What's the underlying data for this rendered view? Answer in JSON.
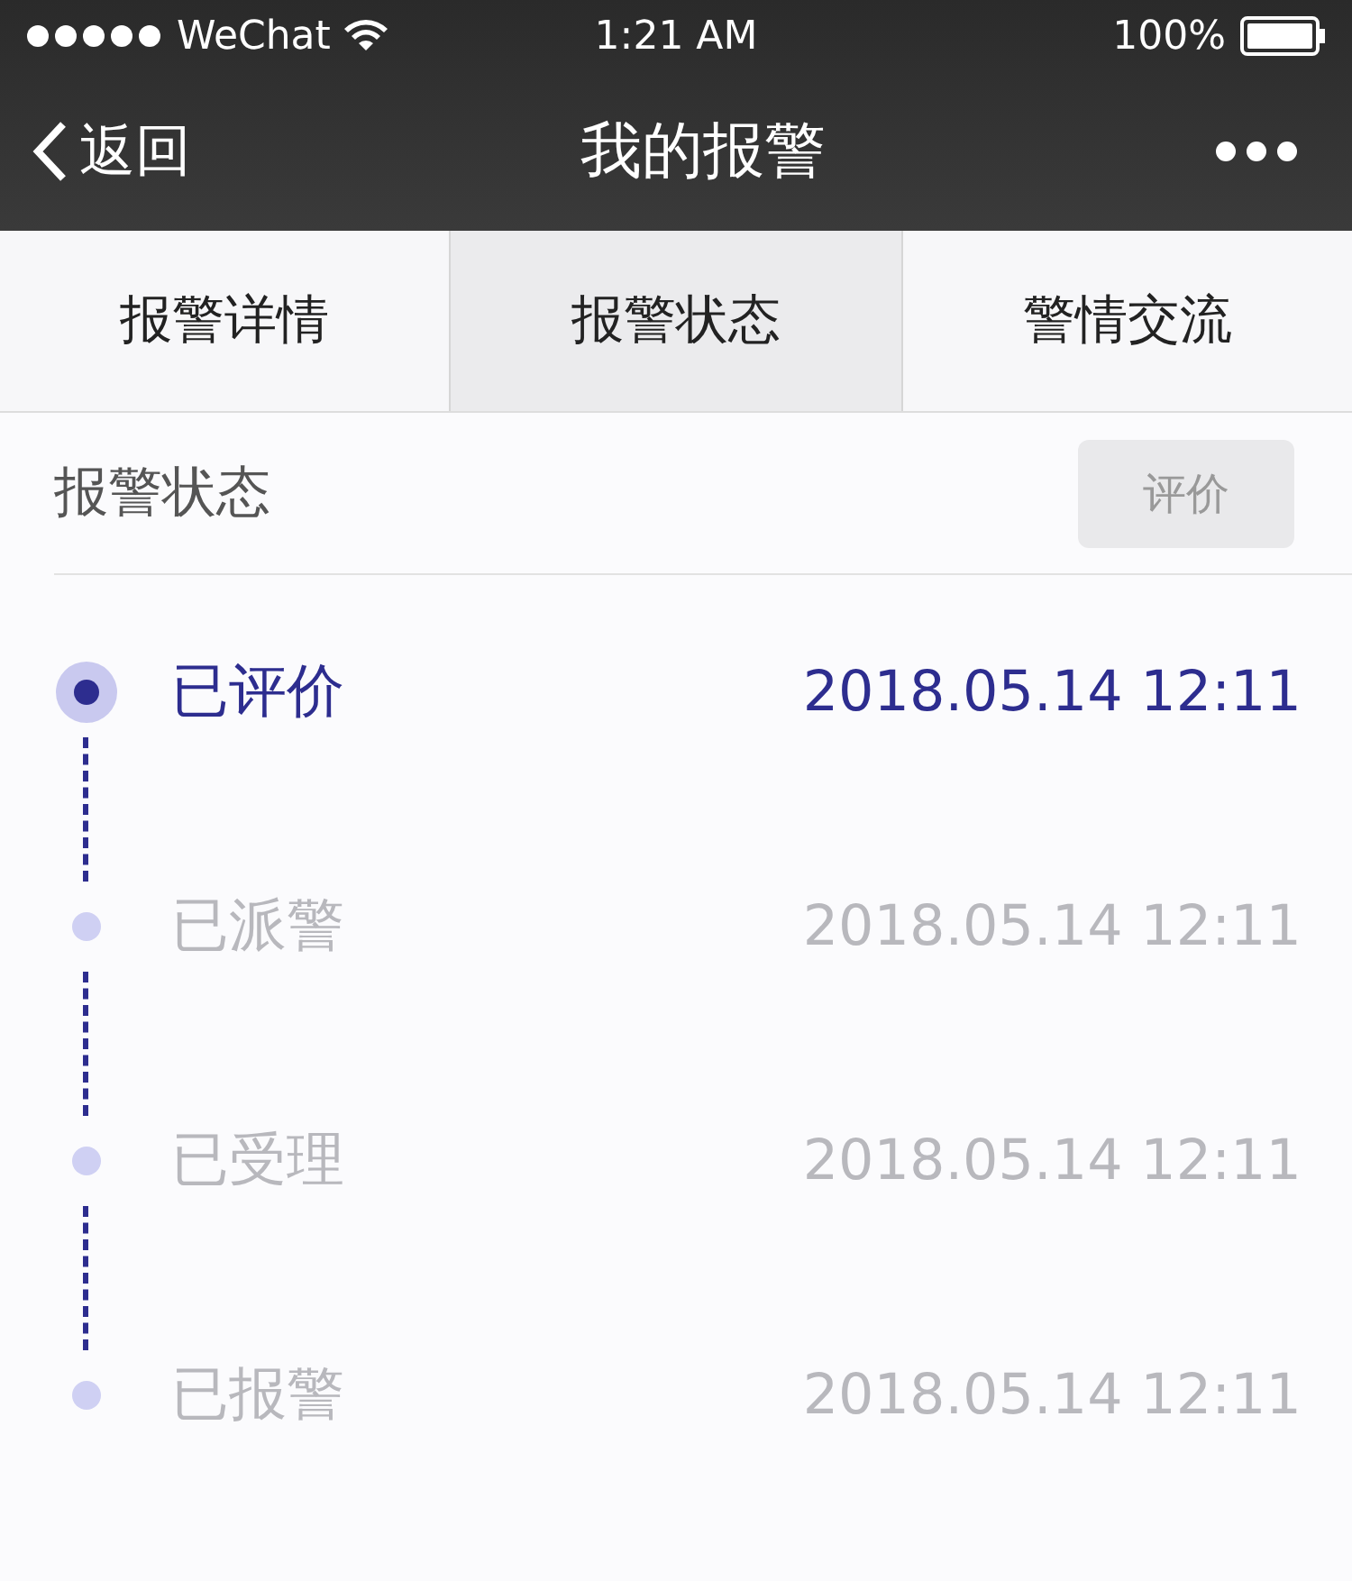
{
  "status_bar": {
    "carrier": "WeChat",
    "time": "1:21 AM",
    "battery": "100%"
  },
  "nav": {
    "back": "返回",
    "title": "我的报警"
  },
  "tabs": [
    {
      "label": "报警详情",
      "selected": false
    },
    {
      "label": "报警状态",
      "selected": true
    },
    {
      "label": "警情交流",
      "selected": false
    }
  ],
  "section": {
    "title": "报警状态",
    "button": {
      "label": "评价",
      "disabled": true
    }
  },
  "timeline": [
    {
      "label": "已评价",
      "time": "2018.05.14 12:11",
      "active": true
    },
    {
      "label": "已派警",
      "time": "2018.05.14 12:11",
      "active": false
    },
    {
      "label": "已受理",
      "time": "2018.05.14 12:11",
      "active": false
    },
    {
      "label": "已报警",
      "time": "2018.05.14 12:11",
      "active": false
    }
  ]
}
